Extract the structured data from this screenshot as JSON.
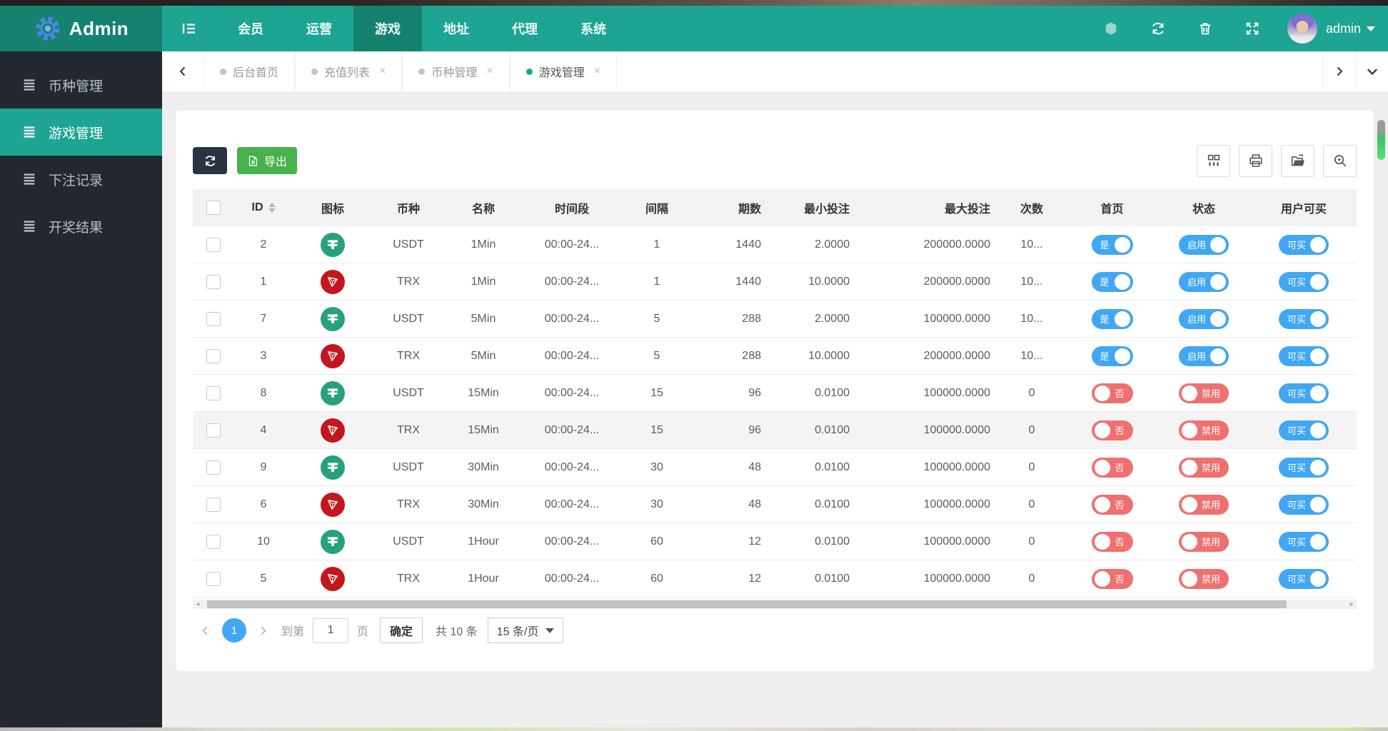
{
  "colors": {
    "accent_teal": "#1ea493",
    "navbar_dark": "#15826f",
    "sidebar_bg": "#232830",
    "toggle_on_blue": "#42a7f3",
    "toggle_off_red": "#f07070",
    "export_green": "#47b14b",
    "usdt_green": "#26a17b",
    "trx_red": "#c4161e"
  },
  "icons": [
    "gear-icon",
    "menu-fold-icon",
    "hexagon-icon",
    "refresh-icon",
    "trash-icon",
    "fullscreen-icon",
    "list-icon",
    "excel-file-icon",
    "columns-icon",
    "print-icon",
    "export-data-icon",
    "search-icon",
    "sort-icon",
    "usdt-icon",
    "tron-icon",
    "chevron-left-icon",
    "chevron-right-icon",
    "chevron-down-icon"
  ],
  "navbar": {
    "brand": "Admin",
    "items": [
      {
        "label": "会员",
        "active": false
      },
      {
        "label": "运营",
        "active": false
      },
      {
        "label": "游戏",
        "active": true
      },
      {
        "label": "地址",
        "active": false
      },
      {
        "label": "代理",
        "active": false
      },
      {
        "label": "系统",
        "active": false
      }
    ],
    "user": "admin"
  },
  "tabs": [
    {
      "label": "后台首页",
      "closable": false,
      "active": false
    },
    {
      "label": "充值列表",
      "closable": true,
      "active": false
    },
    {
      "label": "币种管理",
      "closable": true,
      "active": false
    },
    {
      "label": "游戏管理",
      "closable": true,
      "active": true
    }
  ],
  "sidebar": {
    "items": [
      {
        "label": "币种管理",
        "active": false
      },
      {
        "label": "游戏管理",
        "active": true
      },
      {
        "label": "下注记录",
        "active": false
      },
      {
        "label": "开奖结果",
        "active": false
      }
    ]
  },
  "toolbar": {
    "export_label": "导出"
  },
  "table": {
    "columns": [
      "ID",
      "图标",
      "币种",
      "名称",
      "时间段",
      "间隔",
      "期数",
      "最小投注",
      "最大投注",
      "次数",
      "首页",
      "状态",
      "用户可买"
    ],
    "rows": [
      {
        "id": "2",
        "is_usdt": true,
        "is_trx": false,
        "coin": "USDT",
        "name": "1Min",
        "period": "00:00-24...",
        "interval": "1",
        "issues": "1440",
        "min_bet": "2.0000",
        "max_bet": "200000.0000",
        "times": "10...",
        "home": {
          "label": "是",
          "off": false
        },
        "status": {
          "label": "启用",
          "off": false
        },
        "buy": {
          "label": "可买",
          "off": false
        },
        "highlighted": false
      },
      {
        "id": "1",
        "is_usdt": false,
        "is_trx": true,
        "coin": "TRX",
        "name": "1Min",
        "period": "00:00-24...",
        "interval": "1",
        "issues": "1440",
        "min_bet": "10.0000",
        "max_bet": "200000.0000",
        "times": "10...",
        "home": {
          "label": "是",
          "off": false
        },
        "status": {
          "label": "启用",
          "off": false
        },
        "buy": {
          "label": "可买",
          "off": false
        },
        "highlighted": false
      },
      {
        "id": "7",
        "is_usdt": true,
        "is_trx": false,
        "coin": "USDT",
        "name": "5Min",
        "period": "00:00-24...",
        "interval": "5",
        "issues": "288",
        "min_bet": "2.0000",
        "max_bet": "100000.0000",
        "times": "10...",
        "home": {
          "label": "是",
          "off": false
        },
        "status": {
          "label": "启用",
          "off": false
        },
        "buy": {
          "label": "可买",
          "off": false
        },
        "highlighted": false
      },
      {
        "id": "3",
        "is_usdt": false,
        "is_trx": true,
        "coin": "TRX",
        "name": "5Min",
        "period": "00:00-24...",
        "interval": "5",
        "issues": "288",
        "min_bet": "10.0000",
        "max_bet": "200000.0000",
        "times": "10...",
        "home": {
          "label": "是",
          "off": false
        },
        "status": {
          "label": "启用",
          "off": false
        },
        "buy": {
          "label": "可买",
          "off": false
        },
        "highlighted": false
      },
      {
        "id": "8",
        "is_usdt": true,
        "is_trx": false,
        "coin": "USDT",
        "name": "15Min",
        "period": "00:00-24...",
        "interval": "15",
        "issues": "96",
        "min_bet": "0.0100",
        "max_bet": "100000.0000",
        "times": "0",
        "home": {
          "label": "否",
          "off": true
        },
        "status": {
          "label": "禁用",
          "off": true
        },
        "buy": {
          "label": "可买",
          "off": false
        },
        "highlighted": false
      },
      {
        "id": "4",
        "is_usdt": false,
        "is_trx": true,
        "coin": "TRX",
        "name": "15Min",
        "period": "00:00-24...",
        "interval": "15",
        "issues": "96",
        "min_bet": "0.0100",
        "max_bet": "100000.0000",
        "times": "0",
        "home": {
          "label": "否",
          "off": true
        },
        "status": {
          "label": "禁用",
          "off": true
        },
        "buy": {
          "label": "可买",
          "off": false
        },
        "highlighted": true
      },
      {
        "id": "9",
        "is_usdt": true,
        "is_trx": false,
        "coin": "USDT",
        "name": "30Min",
        "period": "00:00-24...",
        "interval": "30",
        "issues": "48",
        "min_bet": "0.0100",
        "max_bet": "100000.0000",
        "times": "0",
        "home": {
          "label": "否",
          "off": true
        },
        "status": {
          "label": "禁用",
          "off": true
        },
        "buy": {
          "label": "可买",
          "off": false
        },
        "highlighted": false
      },
      {
        "id": "6",
        "is_usdt": false,
        "is_trx": true,
        "coin": "TRX",
        "name": "30Min",
        "period": "00:00-24...",
        "interval": "30",
        "issues": "48",
        "min_bet": "0.0100",
        "max_bet": "100000.0000",
        "times": "0",
        "home": {
          "label": "否",
          "off": true
        },
        "status": {
          "label": "禁用",
          "off": true
        },
        "buy": {
          "label": "可买",
          "off": false
        },
        "highlighted": false
      },
      {
        "id": "10",
        "is_usdt": true,
        "is_trx": false,
        "coin": "USDT",
        "name": "1Hour",
        "period": "00:00-24...",
        "interval": "60",
        "issues": "12",
        "min_bet": "0.0100",
        "max_bet": "100000.0000",
        "times": "0",
        "home": {
          "label": "否",
          "off": true
        },
        "status": {
          "label": "禁用",
          "off": true
        },
        "buy": {
          "label": "可买",
          "off": false
        },
        "highlighted": false
      },
      {
        "id": "5",
        "is_usdt": false,
        "is_trx": true,
        "coin": "TRX",
        "name": "1Hour",
        "period": "00:00-24...",
        "interval": "60",
        "issues": "12",
        "min_bet": "0.0100",
        "max_bet": "100000.0000",
        "times": "0",
        "home": {
          "label": "否",
          "off": true
        },
        "status": {
          "label": "禁用",
          "off": true
        },
        "buy": {
          "label": "可买",
          "off": false
        },
        "highlighted": false
      }
    ]
  },
  "pagination": {
    "current": "1",
    "goto_label": "到第",
    "goto_value": "1",
    "page_label": "页",
    "confirm": "确定",
    "total": "共 10 条",
    "per_page": "15 条/页"
  }
}
